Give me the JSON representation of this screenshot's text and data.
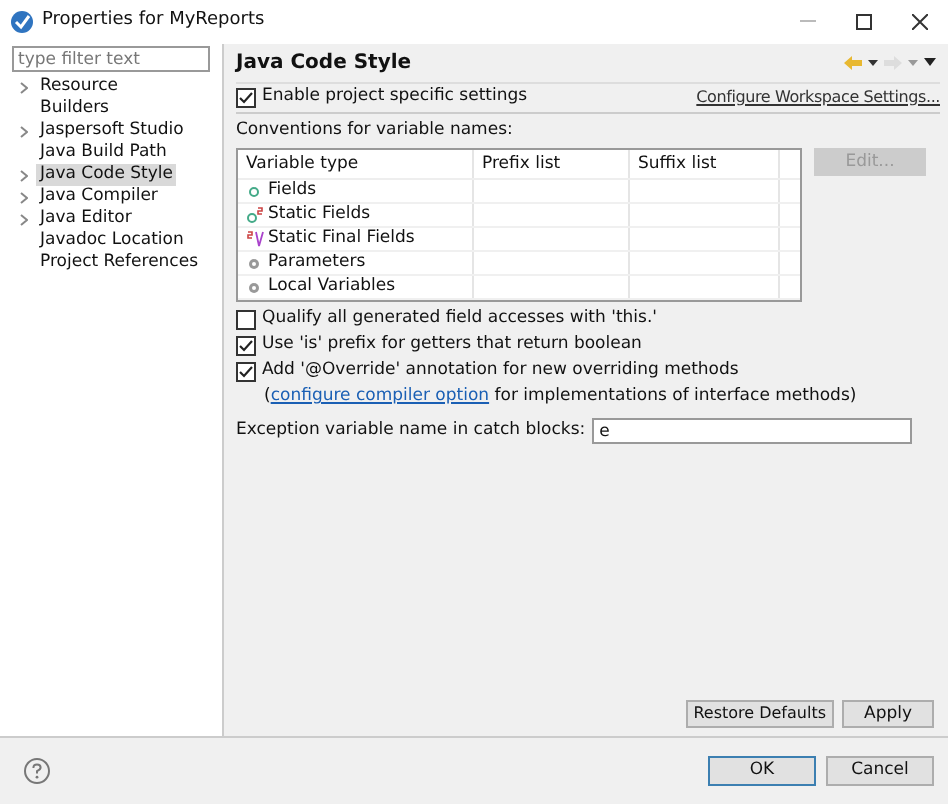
{
  "window": {
    "title": "Properties for MyReports"
  },
  "filter": {
    "placeholder": "type filter text"
  },
  "tree": [
    {
      "label": "Resource",
      "expandable": true,
      "selected": false
    },
    {
      "label": "Builders",
      "expandable": false,
      "selected": false
    },
    {
      "label": "Jaspersoft Studio",
      "expandable": true,
      "selected": false
    },
    {
      "label": "Java Build Path",
      "expandable": false,
      "selected": false
    },
    {
      "label": "Java Code Style",
      "expandable": true,
      "selected": true
    },
    {
      "label": "Java Compiler",
      "expandable": true,
      "selected": false
    },
    {
      "label": "Java Editor",
      "expandable": true,
      "selected": false
    },
    {
      "label": "Javadoc Location",
      "expandable": false,
      "selected": false
    },
    {
      "label": "Project References",
      "expandable": false,
      "selected": false
    }
  ],
  "page": {
    "title": "Java Code Style",
    "enable": {
      "label": "Enable project specific settings",
      "checked": true
    },
    "workspace_link": "Configure Workspace Settings...",
    "conventions_label": "Conventions for variable names:",
    "table": {
      "columns": [
        "Variable type",
        "Prefix list",
        "Suffix list"
      ],
      "rows": [
        {
          "label": "Fields",
          "kind": "field"
        },
        {
          "label": "Static Fields",
          "kind": "static"
        },
        {
          "label": "Static Final Fields",
          "kind": "final"
        },
        {
          "label": "Parameters",
          "kind": "param"
        },
        {
          "label": "Local Variables",
          "kind": "param"
        }
      ]
    },
    "edit_button": {
      "label": "Edit...",
      "disabled": true
    },
    "options": [
      {
        "label": "Qualify all generated field accesses with 'this.'",
        "checked": false
      },
      {
        "label": "Use 'is' prefix for getters that return boolean",
        "checked": true
      },
      {
        "label": "Add '@Override' annotation for new overriding methods",
        "checked": true
      }
    ],
    "note": {
      "open": "(",
      "link": "configure compiler option",
      "rest": " for implementations of interface methods)"
    },
    "exception": {
      "label": "Exception variable name in catch blocks:",
      "value": "e"
    },
    "restore_button": "Restore Defaults",
    "apply_button": "Apply"
  },
  "footer": {
    "ok": "OK",
    "cancel": "Cancel"
  }
}
